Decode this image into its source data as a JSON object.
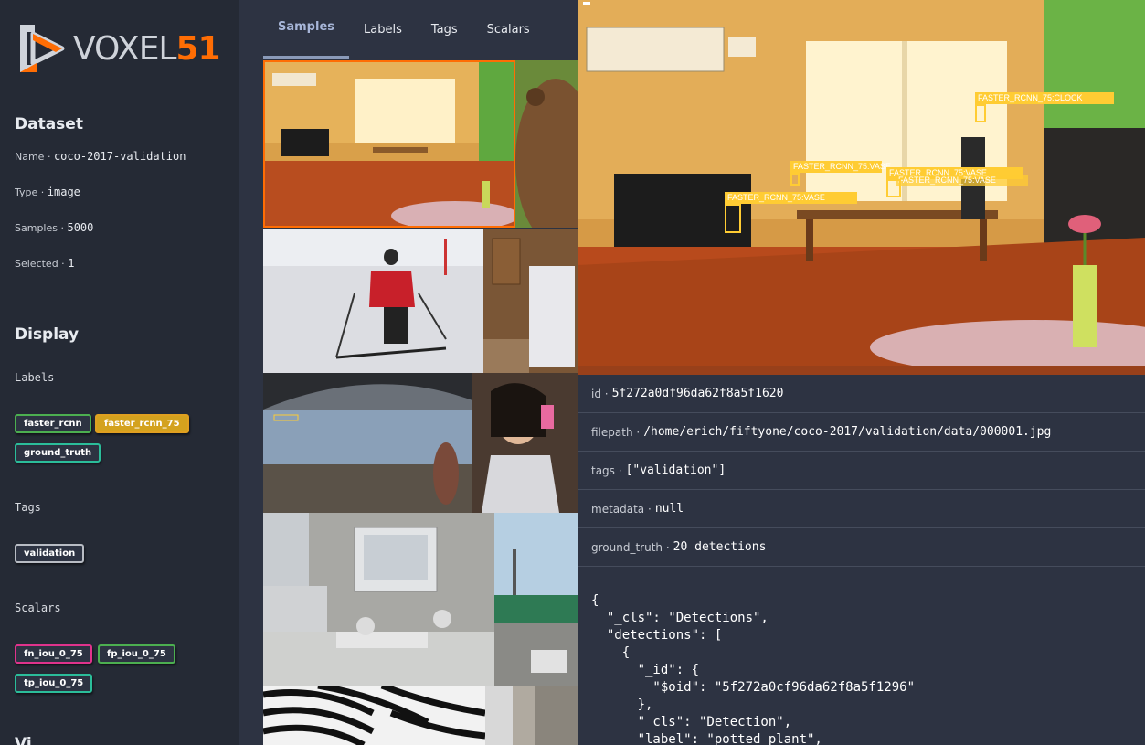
{
  "brand": {
    "voxel": "VOXEL",
    "num": "51"
  },
  "dataset": {
    "title": "Dataset",
    "fields": [
      {
        "key": "Name",
        "value": "coco-2017-validation"
      },
      {
        "key": "Type",
        "value": "image"
      },
      {
        "key": "Samples",
        "value": "5000"
      },
      {
        "key": "Selected",
        "value": "1"
      }
    ]
  },
  "display": {
    "title": "Display",
    "labels_title": "Labels",
    "labels": [
      {
        "text": "faster_rcnn",
        "color": "#4caf50",
        "bg": "#2d3342"
      },
      {
        "text": "faster_rcnn_75",
        "color": "#e0a020",
        "bg": "#d4a21e"
      },
      {
        "text": "ground_truth",
        "color": "#2bbd9a",
        "bg": "#2d3342"
      }
    ],
    "tags_title": "Tags",
    "tags": [
      {
        "text": "validation",
        "color": "#b8bcc4"
      }
    ],
    "scalars_title": "Scalars",
    "scalars": [
      {
        "text": "fn_iou_0_75",
        "color": "#e0338c"
      },
      {
        "text": "fp_iou_0_75",
        "color": "#4caf50"
      },
      {
        "text": "tp_iou_0_75",
        "color": "#2bbd9a"
      }
    ],
    "next_title": "Vi..."
  },
  "tabs": [
    {
      "label": "Samples",
      "active": true
    },
    {
      "label": "Labels",
      "active": false
    },
    {
      "label": "Tags",
      "active": false
    },
    {
      "label": "Scalars",
      "active": false
    }
  ],
  "sample": {
    "fields": [
      {
        "key": "id",
        "value": "5f272a0df96da62f8a5f1620"
      },
      {
        "key": "filepath",
        "value": "/home/erich/fiftyone/coco-2017/validation/data/000001.jpg"
      },
      {
        "key": "tags",
        "value": "[\"validation\"]"
      },
      {
        "key": "metadata",
        "value": "null"
      },
      {
        "key": "ground_truth",
        "value": "20 detections"
      }
    ],
    "json_lines": [
      "{",
      "  \"_cls\": \"Detections\",",
      "  \"detections\": [",
      "    {",
      "      \"_id\": {",
      "        \"$oid\": \"5f272a0cf96da62f8a5f1296\"",
      "      },",
      "      \"_cls\": \"Detection\",",
      "      \"label\": \"potted plant\","
    ],
    "detections": [
      {
        "label": "FASTER_RCNN_75:CLOCK"
      },
      {
        "label": "FASTER_RCNN_75:VASE"
      },
      {
        "label": "FASTER_RCNN_75:VASE"
      },
      {
        "label": "FASTER_RCNN_75:VASE"
      },
      {
        "label": "FASTER_RCNN_75:VASE"
      }
    ]
  },
  "colors": {
    "accent": "#ff6d04",
    "sidebar_bg": "#252a35",
    "panel_bg": "#2d3342",
    "detection": "#ffcc33"
  }
}
